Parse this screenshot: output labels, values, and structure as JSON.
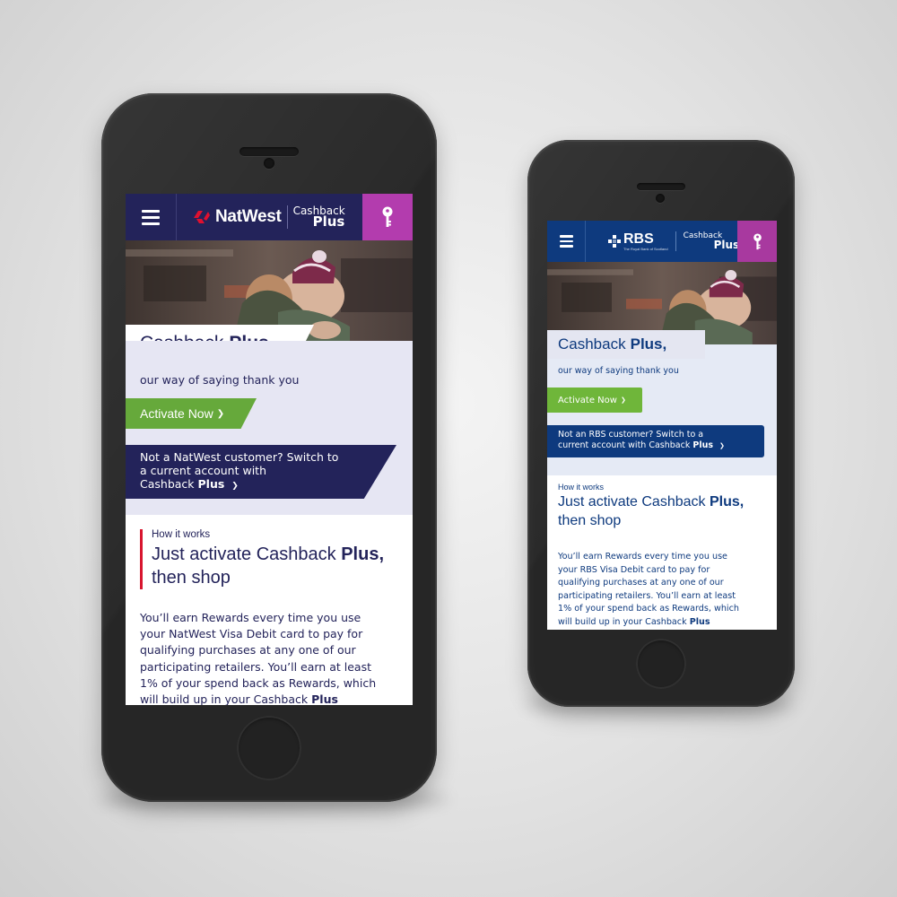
{
  "natwest": {
    "brand_name": "NatWest",
    "product_top": "Cashback",
    "product_bottom": "Plus",
    "headline_a": "Cashback",
    "headline_b": "Plus,",
    "tagline": "our way of saying thank you",
    "cta": "Activate Now",
    "cta_chevron": "❯",
    "switch_line1": "Not a NatWest customer? Switch to",
    "switch_line2": "a current account with",
    "switch_line3a": "Cashback",
    "switch_line3b": "Plus",
    "switch_chevron": "❯",
    "how_small": "How it works",
    "how_title_a": "Just activate Cashback",
    "how_title_b": "Plus,",
    "how_title_c": "then shop",
    "body_lines": [
      "You’ll earn Rewards every time you use",
      "your NatWest Visa Debit card to pay for",
      "qualifying purchases at any one of our",
      "participating retailers. You’ll earn at least",
      "1% of your spend back as Rewards, which"
    ],
    "body_last_a": "will build up in your Cashback",
    "body_last_b": "Plus",
    "colors": {
      "header": "#23235a",
      "key": "#b33cae",
      "cta": "#66a93b",
      "accent_bar": "#d8162f"
    },
    "icons": [
      "menu-icon",
      "natwest-logo-icon",
      "key-icon",
      "chevron-right-icon"
    ]
  },
  "rbs": {
    "brand_name": "RBS",
    "brand_sub": "The Royal Bank of Scotland",
    "product_top": "Cashback",
    "product_bottom": "Plus",
    "headline_a": "Cashback",
    "headline_b": "Plus,",
    "tagline": "our way of saying thank you",
    "cta": "Activate Now",
    "cta_chevron": "❯",
    "switch_line1": "Not an RBS customer? Switch to a",
    "switch_line2a": "current account with Cashback",
    "switch_line2b": "Plus",
    "switch_chevron": "❯",
    "how_small": "How it works",
    "how_title_a": "Just activate Cashback",
    "how_title_b": "Plus,",
    "how_title_c": "then shop",
    "body_lines": [
      "You’ll earn Rewards every time you use",
      "your RBS Visa Debit card to pay for",
      "qualifying purchases at any one of our",
      "participating retailers. You’ll earn at least",
      "1% of your spend back as Rewards, which"
    ],
    "body_last_a": "will build up in your Cashback",
    "body_last_b": "Plus",
    "colors": {
      "header": "#0e3a7e",
      "key": "#a8399f",
      "cta": "#6fb63a"
    },
    "icons": [
      "menu-icon",
      "rbs-logo-icon",
      "key-icon",
      "chevron-right-icon"
    ]
  }
}
